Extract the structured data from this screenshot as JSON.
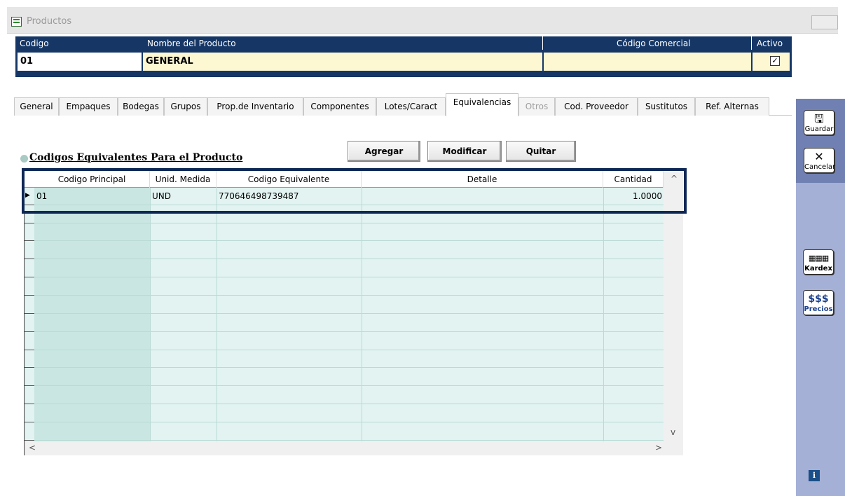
{
  "window": {
    "title": "Productos"
  },
  "header": {
    "labels": {
      "codigo": "Codigo",
      "nombre": "Nombre del Producto",
      "codigo_comercial": "Código Comercial",
      "activo": "Activo"
    },
    "values": {
      "codigo": "01",
      "nombre": "GENERAL",
      "codigo_comercial": "",
      "activo": "✓"
    }
  },
  "tabs": [
    {
      "label": "General"
    },
    {
      "label": "Empaques"
    },
    {
      "label": "Bodegas"
    },
    {
      "label": "Grupos"
    },
    {
      "label": "Prop.de Inventario"
    },
    {
      "label": "Componentes"
    },
    {
      "label": "Lotes/Caract"
    },
    {
      "label": "Equivalencias",
      "active": true
    },
    {
      "label": "Otros",
      "disabled": true
    },
    {
      "label": "Cod. Proveedor"
    },
    {
      "label": "Sustitutos"
    },
    {
      "label": "Ref. Alternas"
    }
  ],
  "section": {
    "title": "Codigos Equivalentes Para el Producto"
  },
  "actions": {
    "agregar": "Agregar",
    "modificar": "Modificar",
    "quitar": "Quitar"
  },
  "table": {
    "columns": [
      "Codigo Principal",
      "Unid. Medida",
      "Codigo Equivalente",
      "Detalle",
      "Cantidad"
    ],
    "rows": [
      [
        "01",
        "UND",
        "770646498739487",
        "",
        "1.0000"
      ]
    ]
  },
  "side": {
    "guardar": "Guardar",
    "cancelar": "Cancelar",
    "kardex": "Kardex",
    "precios_symbol": "$$$",
    "precios": "Precios",
    "info": "i"
  },
  "colors": {
    "header_bg": "#163766",
    "grid_bg": "#e2f3f1",
    "side_panel": "#a5b0d6",
    "highlight": "#0e2856"
  }
}
